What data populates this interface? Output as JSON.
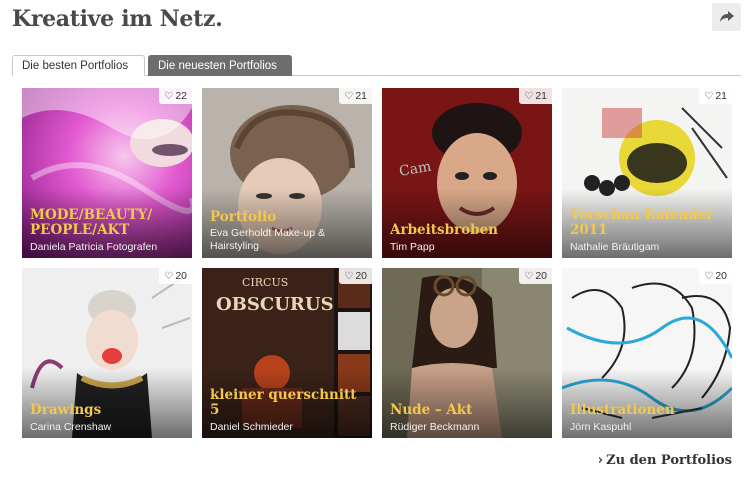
{
  "header": {
    "title": "Kreative im Netz.",
    "share_icon": "share-arrow-icon"
  },
  "tabs": [
    {
      "label": "Die besten Portfolios",
      "active": true
    },
    {
      "label": "Die neuesten Portfolios",
      "active": false
    }
  ],
  "portfolios": [
    {
      "likes": "22",
      "title": "MODE/BEAUTY/ PEOPLE/AKT",
      "author": "Daniela Patricia Fotografen"
    },
    {
      "likes": "21",
      "title": "Portfolio",
      "author": "Eva Gerholdt Make-up & Hairstyling"
    },
    {
      "likes": "21",
      "title": "Arbeitsbroben",
      "author": "Tim Papp"
    },
    {
      "likes": "21",
      "title": "Vorschau Kalender 2011",
      "author": "Nathalie Bräutigam"
    },
    {
      "likes": "20",
      "title": "Drawings",
      "author": "Carina Crenshaw"
    },
    {
      "likes": "20",
      "title": "kleiner querschnitt 5",
      "author": "Daniel Schmieder"
    },
    {
      "likes": "20",
      "title": "Nude – Akt",
      "author": "Rüdiger Beckmann"
    },
    {
      "likes": "20",
      "title": "Illustrationen",
      "author": "Jörn Kaspuhl"
    }
  ],
  "footer": {
    "link_label": "Zu den Portfolios"
  },
  "colors": {
    "title_accent": "#f2c94c",
    "inactive_tab": "#6d6d6d",
    "heading": "#4a4a4a"
  }
}
